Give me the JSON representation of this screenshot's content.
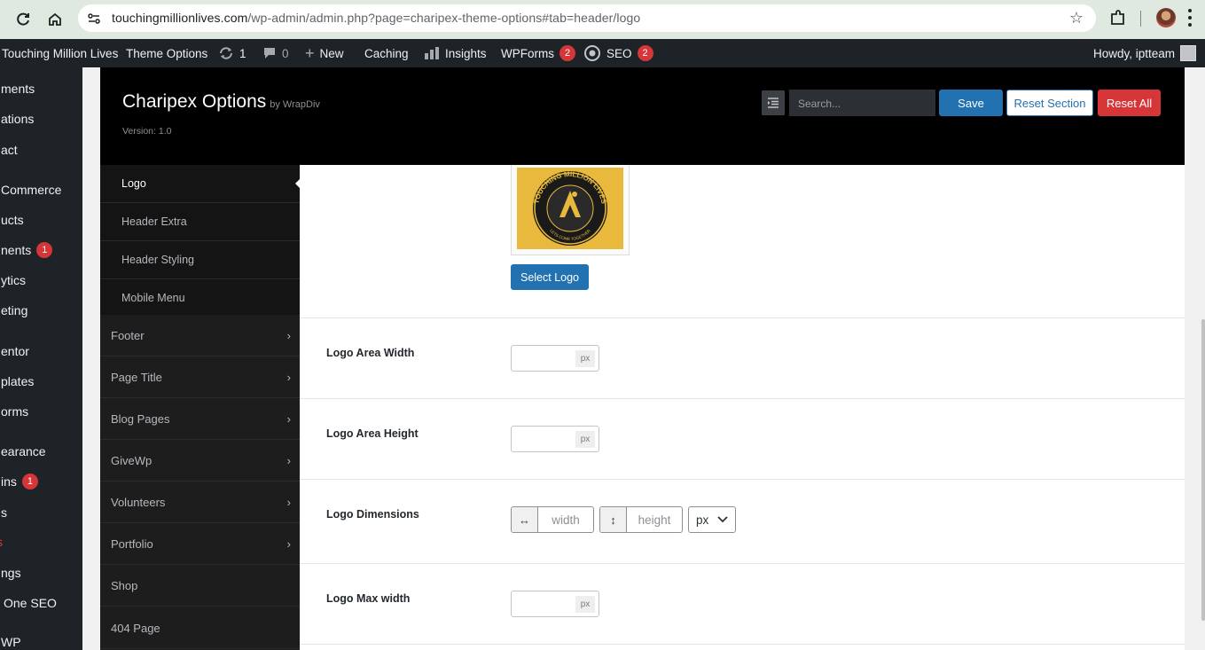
{
  "browser": {
    "url_host": "touchingmillionlives.com",
    "url_path": "/wp-admin/admin.php?page=charipex-theme-options#tab=header/logo",
    "icons": [
      "reload-icon",
      "home-icon",
      "site-settings-icon",
      "bookmark-star-icon",
      "extensions-icon",
      "profile-avatar",
      "menu-kebab-icon"
    ]
  },
  "adminbar": {
    "site_name": "Touching Million Lives",
    "theme_options": "Theme Options",
    "updates_count": "1",
    "comments_count": "0",
    "new_label": "New",
    "caching_label": "Caching",
    "insights_label": "Insights",
    "wpforms_label": "WPForms",
    "wpforms_badge": "2",
    "seo_label": "SEO",
    "seo_badge": "2",
    "howdy": "Howdy, iptteam"
  },
  "wp_menu": {
    "items": [
      {
        "label": "ments"
      },
      {
        "label": "ations"
      },
      {
        "label": "act"
      },
      {
        "label": "Commerce"
      },
      {
        "label": "ucts"
      },
      {
        "label": "nents",
        "badge": "1"
      },
      {
        "label": "ytics"
      },
      {
        "label": "eting"
      },
      {
        "label": "entor"
      },
      {
        "label": "plates"
      },
      {
        "label": "orms"
      },
      {
        "label": "earance"
      },
      {
        "label": "ins",
        "badge": "1"
      },
      {
        "label": "s"
      },
      {
        "label": "s"
      },
      {
        "label": "ngs"
      },
      {
        "label": "One SEO"
      },
      {
        "label": "WP"
      }
    ]
  },
  "options": {
    "title": "Charipex Options",
    "by": "by WrapDiv",
    "version": "Version: 1.0",
    "search_placeholder": "Search...",
    "save": "Save",
    "reset_section": "Reset Section",
    "reset_all": "Reset All"
  },
  "nav": {
    "sub_items": [
      "Logo",
      "Header Extra",
      "Header Styling",
      "Mobile Menu"
    ],
    "sections": [
      "Footer",
      "Page Title",
      "Blog Pages",
      "GiveWp",
      "Volunteers",
      "Portfolio",
      "Shop",
      "404 Page"
    ]
  },
  "content": {
    "logo_text_top": "TOUCHING MILLION LIVES",
    "logo_text_bottom": "LETS COME TOGETHER",
    "select_logo": "Select Logo",
    "fields": {
      "logo_area_width": {
        "label": "Logo Area Width",
        "unit": "px",
        "value": ""
      },
      "logo_area_height": {
        "label": "Logo Area Height",
        "unit": "px",
        "value": ""
      },
      "logo_dimensions": {
        "label": "Logo Dimensions",
        "width_placeholder": "width",
        "height_placeholder": "height",
        "unit": "px"
      },
      "logo_max_width": {
        "label": "Logo Max width",
        "unit": "px",
        "value": ""
      }
    }
  },
  "colors": {
    "accent": "#2271b1",
    "danger": "#d63638",
    "header_bg": "#000000",
    "admin_bar": "#1d2327"
  }
}
